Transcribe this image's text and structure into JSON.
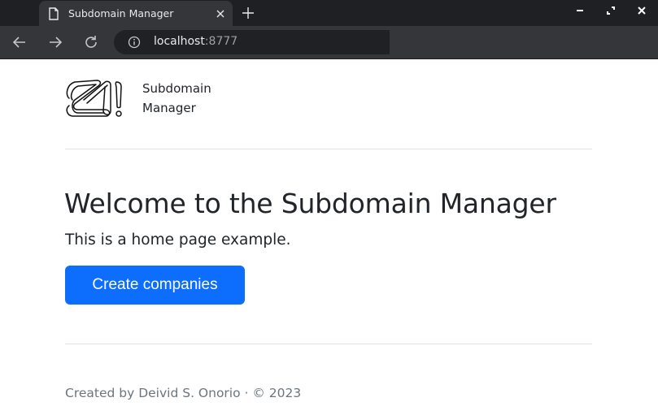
{
  "browser": {
    "tab_title": "Subdomain Manager",
    "url_host": "localhost",
    "url_port": ":8777"
  },
  "header": {
    "brand_line1": "Subdomain",
    "brand_line2": "Manager"
  },
  "hero": {
    "title": "Welcome to the Subdomain Manager",
    "subtitle": "This is a home page example.",
    "cta_label": "Create companies"
  },
  "footer": {
    "text": "Created by Deivid S. Onorio · © 2023"
  },
  "colors": {
    "primary": "#0d6efd",
    "text": "#212529",
    "muted": "#6c757d",
    "divider": "#dee2e6"
  }
}
